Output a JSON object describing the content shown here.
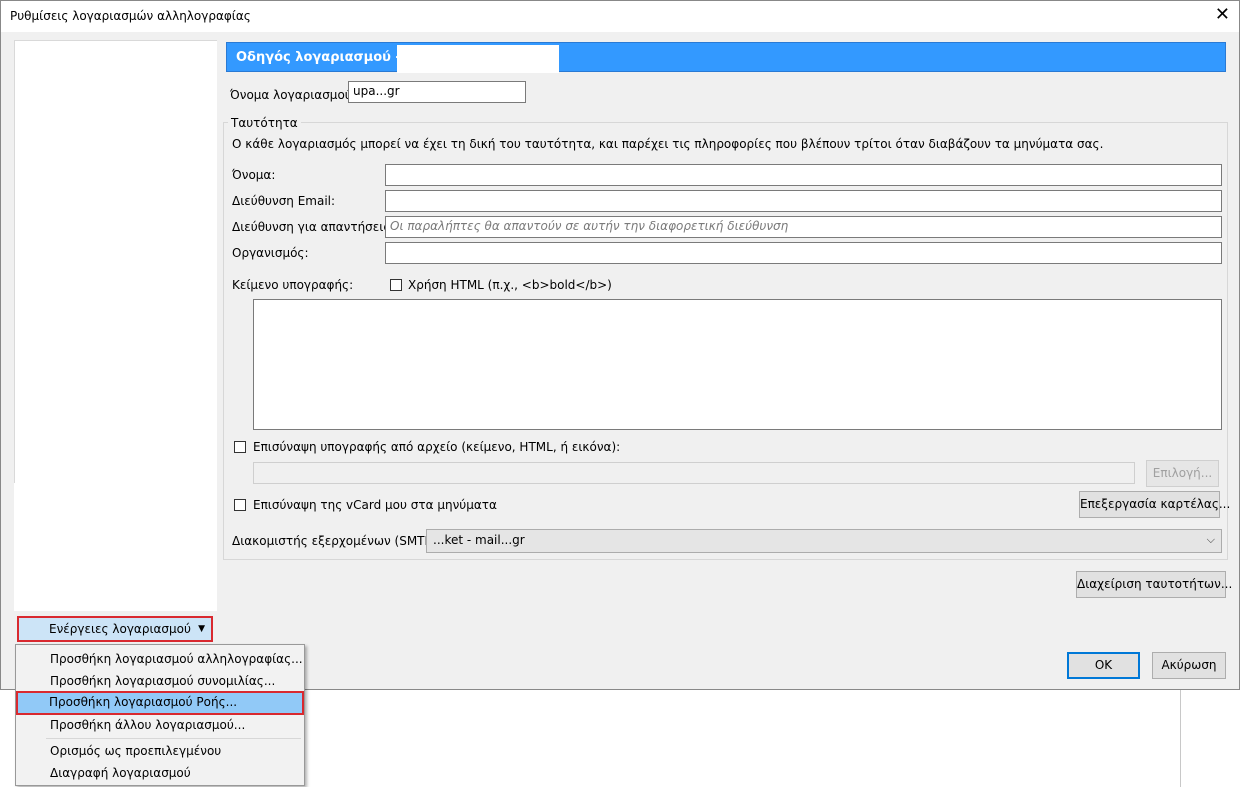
{
  "window": {
    "title": "Ρυθμίσεις λογαριασμών αλληλογραφίας",
    "close_glyph": "✕"
  },
  "header": {
    "title": "Οδηγός λογαριασμού -"
  },
  "account": {
    "name_label": "Όνομα λογαριασμού:",
    "name_value": "upa...gr"
  },
  "identity": {
    "group_title": "Ταυτότητα",
    "description": "Ο κάθε λογαριασμός μπορεί να έχει τη δική του ταυτότητα, και παρέχει τις πληροφορίες που βλέπουν τρίτοι όταν διαβάζουν τα μηνύματα σας.",
    "fields": {
      "name_label": "Όνομα:",
      "name_value": "",
      "email_label": "Διεύθυνση Email:",
      "email_value": "",
      "reply_label": "Διεύθυνση για απαντήσεις:",
      "reply_placeholder": "Οι παραλήπτες θα απαντούν σε αυτήν την διαφορετική διεύθυνση",
      "org_label": "Οργανισμός:",
      "org_value": ""
    },
    "signature": {
      "label": "Κείμενο υπογραφής:",
      "html_checkbox_label": "Χρήση HTML (π.χ., <b>bold</b>)",
      "html_checked": false,
      "text": ""
    },
    "attach_signature": {
      "label": "Επισύναψη υπογραφής από αρχείο (κείμενο, HTML, ή εικόνα):",
      "checked": false,
      "path": "",
      "choose_button": "Επιλογή..."
    },
    "vcard": {
      "label": "Επισύναψη της vCard μου στα μηνύματα",
      "checked": false,
      "edit_button": "Επεξεργασία καρτέλας..."
    },
    "smtp": {
      "label": "Διακομιστής εξερχομένων (SMTP):",
      "value": "...ket - mail...gr"
    }
  },
  "buttons": {
    "manage_identities": "Διαχείριση ταυτοτήτων...",
    "ok": "OK",
    "cancel": "Ακύρωση"
  },
  "account_actions": {
    "button_label": "Ενέργειες λογαριασμού",
    "menu_items": [
      "Προσθήκη λογαριασμού αλληλογραφίας...",
      "Προσθήκη λογαριασμού συνομιλίας...",
      "Προσθήκη λογαριασμού Ροής...",
      "Προσθήκη άλλου λογαριασμού...",
      "Ορισμός ως προεπιλεγμένου",
      "Διαγραφή λογαριασμού"
    ],
    "highlighted_index": 2
  },
  "colors": {
    "header_banner": "#3399ff",
    "highlight_border": "#d9292f",
    "menu_highlight": "#91c9f7"
  }
}
